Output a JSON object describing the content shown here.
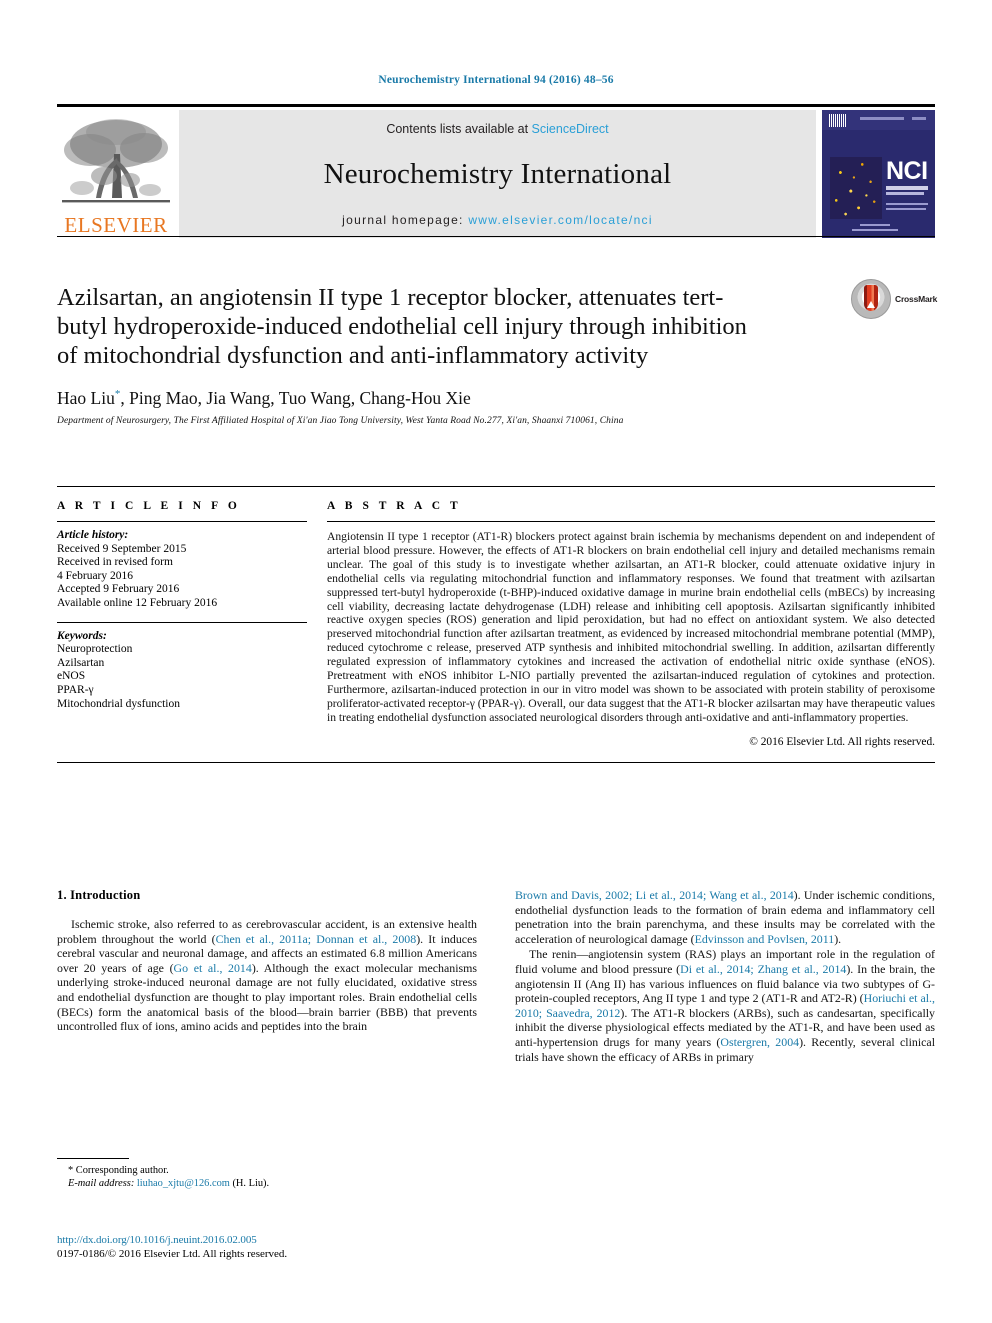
{
  "running_head": "Neurochemistry International 94 (2016) 48–56",
  "masthead": {
    "publisher_wordmark": "ELSEVIER",
    "contents_prefix": "Contents lists available at ",
    "contents_link": "ScienceDirect",
    "journal_name": "Neurochemistry International",
    "homepage_prefix": "journal homepage: ",
    "homepage_url": "www.elsevier.com/locate/nci",
    "cover_acronym": "NCI"
  },
  "title": "Azilsartan, an angiotensin II type 1 receptor blocker, attenuates tert-butyl hydroperoxide-induced endothelial cell injury through inhibition of mitochondrial dysfunction and anti-inflammatory activity",
  "crossmark_label": "CrossMark",
  "authors": "Hao Liu",
  "authors_rest": ", Ping Mao, Jia Wang, Tuo Wang, Chang-Hou Xie",
  "corresponding_marker": "*",
  "affiliation": "Department of Neurosurgery, The First Affiliated Hospital of Xi'an Jiao Tong University, West Yanta Road No.277, Xi'an, Shaanxi 710061, China",
  "article_info": {
    "heading": "A R T I C L E  I N F O",
    "history_label": "Article history:",
    "history": [
      "Received 9 September 2015",
      "Received in revised form",
      "4 February 2016",
      "Accepted 9 February 2016",
      "Available online 12 February 2016"
    ],
    "keywords_label": "Keywords:",
    "keywords": [
      "Neuroprotection",
      "Azilsartan",
      "eNOS",
      "PPAR-γ",
      "Mitochondrial dysfunction"
    ]
  },
  "abstract": {
    "heading": "A B S T R A C T",
    "text": "Angiotensin II type 1 receptor (AT1-R) blockers protect against brain ischemia by mechanisms dependent on and independent of arterial blood pressure. However, the effects of AT1-R blockers on brain endothelial cell injury and detailed mechanisms remain unclear. The goal of this study is to investigate whether azilsartan, an AT1-R blocker, could attenuate oxidative injury in endothelial cells via regulating mitochondrial function and inflammatory responses. We found that treatment with azilsartan suppressed tert-butyl hydroperoxide (t-BHP)-induced oxidative damage in murine brain endothelial cells (mBECs) by increasing cell viability, decreasing lactate dehydrogenase (LDH) release and inhibiting cell apoptosis. Azilsartan significantly inhibited reactive oxygen species (ROS) generation and lipid peroxidation, but had no effect on antioxidant system. We also detected preserved mitochondrial function after azilsartan treatment, as evidenced by increased mitochondrial membrane potential (MMP), reduced cytochrome c release, preserved ATP synthesis and inhibited mitochondrial swelling. In addition, azilsartan differently regulated expression of inflammatory cytokines and increased the activation of endothelial nitric oxide synthase (eNOS). Pretreatment with eNOS inhibitor L-NIO partially prevented the azilsartan-induced regulation of cytokines and protection. Furthermore, azilsartan-induced protection in our in vitro model was shown to be associated with protein stability of peroxisome proliferator-activated receptor-γ (PPAR-γ). Overall, our data suggest that the AT1-R blocker azilsartan may have therapeutic values in treating endothelial dysfunction associated neurological disorders through anti-oxidative and anti-inflammatory properties.",
    "copyright": "© 2016 Elsevier Ltd. All rights reserved."
  },
  "introduction": {
    "heading": "1. Introduction",
    "left_para1_a": "Ischemic stroke, also referred to as cerebrovascular accident, is an extensive health problem throughout the world (",
    "left_cite1": "Chen et al., 2011a; Donnan et al., 2008",
    "left_para1_b": "). It induces cerebral vascular and neuronal damage, and affects an estimated 6.8 million Americans over 20 years of age (",
    "left_cite2": "Go et al., 2014",
    "left_para1_c": "). Although the exact molecular mechanisms underlying stroke-induced neuronal damage are not fully elucidated, oxidative stress and endothelial dysfunction are thought to play important roles. Brain endothelial cells (BECs) form the anatomical basis of the blood—brain barrier (BBB) that prevents uncontrolled flux of ions, amino acids and peptides into the brain",
    "right_cite1": "Brown and Davis, 2002; Li et al., 2014; Wang et al., 2014",
    "right_para1_a": "). Under ischemic conditions, endothelial dysfunction leads to the formation of brain edema and inflammatory cell penetration into the brain parenchyma, and these insults may be correlated with the acceleration of neurological damage (",
    "right_cite2": "Edvinsson and Povlsen, 2011",
    "right_para1_b": ").",
    "right_para2_a": "The renin—angiotensin system (RAS) plays an important role in the regulation of fluid volume and blood pressure (",
    "right_cite3": "Di et al., 2014; Zhang et al., 2014",
    "right_para2_b": "). In the brain, the angiotensin II (Ang II) has various influences on fluid balance via two subtypes of G-protein-coupled receptors, Ang II type 1 and type 2 (AT1-R and AT2-R) (",
    "right_cite4": "Horiuchi et al., 2010; Saavedra, 2012",
    "right_para2_c": "). The AT1-R blockers (ARBs), such as candesartan, specifically inhibit the diverse physiological effects mediated by the AT1-R, and have been used as anti-hypertension drugs for many years (",
    "right_cite5": "Ostergren, 2004",
    "right_para2_d": "). Recently, several clinical trials have shown the efficacy of ARBs in primary"
  },
  "footnotes": {
    "corresponding": "* Corresponding author.",
    "email_label": "E-mail address: ",
    "email": "liuhao_xjtu@126.com",
    "email_suffix": " (H. Liu)."
  },
  "footer": {
    "doi": "http://dx.doi.org/10.1016/j.neuint.2016.02.005",
    "issn": "0197-0186/© 2016 Elsevier Ltd. All rights reserved."
  },
  "colors": {
    "link": "#1a7aa8",
    "sciencedirect": "#2a9fd6",
    "elsevier_orange": "#E87722",
    "cover_navy": "#2a2a6e"
  }
}
